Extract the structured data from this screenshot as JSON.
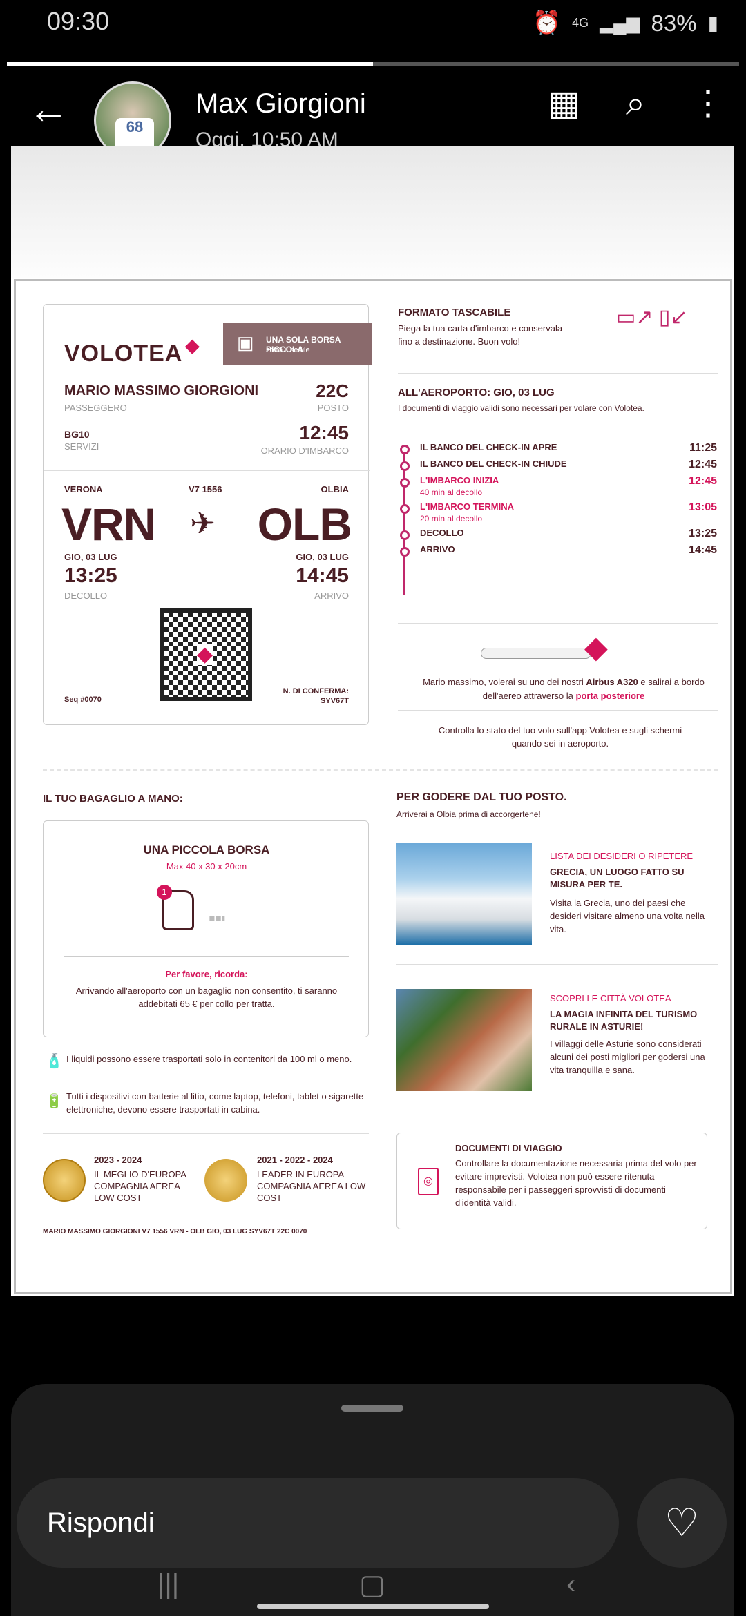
{
  "status_bar": {
    "time": "09:30",
    "network": "4G",
    "battery": "83%"
  },
  "story_progress": 0.5,
  "header": {
    "name": "Max Giorgioni",
    "date": "Oggi, 10:50 AM"
  },
  "boarding_pass": {
    "brand": "VOLOTEA",
    "bag_tag_title": "UNA SOLA BORSA PICCOLA",
    "bag_tag_sub": "sotto il sedile",
    "passenger_name": "MARIO MASSIMO GIORGIONI",
    "passenger_label": "PASSEGGERO",
    "seat": "22C",
    "seat_label": "POSTO",
    "service_code": "BG10",
    "service_label": "SERVIZI",
    "boarding_time": "12:45",
    "boarding_label": "ORARIO D'IMBARCO",
    "from_city": "VERONA",
    "flight": "V7 1556",
    "to_city": "OLBIA",
    "from_code": "VRN",
    "to_code": "OLB",
    "dep_date": "GIO, 03 LUG",
    "arr_date": "GIO, 03 LUG",
    "dep_time": "13:25",
    "arr_time": "14:45",
    "dep_label": "DECOLLO",
    "arr_label": "ARRIVO",
    "seq": "Seq #0070",
    "conf_label": "N. DI CONFERMA:",
    "conf_code": "SYV67T"
  },
  "pocket": {
    "title": "FORMATO TASCABILE",
    "text": "Piega la tua carta d'imbarco e conservala fino a destinazione. Buon volo!"
  },
  "airport": {
    "title": "ALL'AEROPORTO: GIO, 03 LUG",
    "subtitle": "I documenti di viaggio validi sono necessari per volare con Volotea.",
    "steps": [
      {
        "label": "IL BANCO DEL CHECK-IN APRE",
        "sub": "",
        "time": "11:25"
      },
      {
        "label": "IL BANCO DEL CHECK-IN CHIUDE",
        "sub": "",
        "time": "12:45"
      },
      {
        "label": "L'IMBARCO INIZIA",
        "sub": "40  min al decollo",
        "time": "12:45"
      },
      {
        "label": "L'IMBARCO TERMINA",
        "sub": "20  min al decollo",
        "time": "13:05"
      },
      {
        "label": "DECOLLO",
        "sub": "",
        "time": "13:25"
      },
      {
        "label": "ARRIVO",
        "sub": "",
        "time": "14:45"
      }
    ]
  },
  "aircraft": {
    "text_pre": "Mario massimo, volerai su uno dei nostri",
    "aircraft_model": "Airbus A320",
    "text_mid": "e salirai a bordo dell'aereo attraverso la",
    "door": "porta posteriore",
    "app_text": "Controlla lo stato del tuo volo sull'app Volotea e sugli schermi quando sei in aeroporto."
  },
  "baggage": {
    "title": "IL TUO BAGAGLIO A MANO:",
    "item": "UNA PICCOLA BORSA",
    "dims": "Max 40 x 30 x 20cm",
    "badge": "1",
    "remember": "Per favore, ricorda:",
    "remember_text": "Arrivando all'aeroporto con un bagaglio non consentito, ti saranno addebitati 65 € per collo per tratta.",
    "liquids": "I liquidi possono essere trasportati solo in contenitori da 100 ml o meno.",
    "batteries": "Tutti i dispositivi con batterie al litio, come laptop, telefoni, tablet o sigarette elettroniche, devono essere trasportati in cabina."
  },
  "awards": [
    {
      "years": "2023 - 2024",
      "text": "IL MEGLIO D'EUROPA COMPAGNIA AEREA LOW COST"
    },
    {
      "years": "2021 - 2022 - 2024",
      "text": "LEADER IN EUROPA COMPAGNIA AEREA LOW COST"
    }
  ],
  "footer_code": "MARIO MASSIMO GIORGIONI V7 1556 VRN - OLB GIO, 03 LUG SYV67T 22C 0070",
  "enjoy": {
    "title": "PER GODERE DAL TUO POSTO.",
    "subtitle": "Arriverai a Olbia prima di accorgertene!",
    "cards": [
      {
        "tag": "LISTA DEI DESIDERI O RIPETERE",
        "headline": "GRECIA, UN LUOGO FATTO SU MISURA PER TE.",
        "text": "Visita la Grecia, uno dei paesi che desideri visitare almeno una volta nella vita."
      },
      {
        "tag": "SCOPRI LE CITTÀ VOLOTEA",
        "headline": "LA MAGIA INFINITA DEL TURISMO RURALE IN ASTURIE!",
        "text": "I villaggi delle Asturie sono considerati alcuni dei posti migliori per godersi una vita tranquilla e sana."
      }
    ]
  },
  "documents": {
    "title": "DOCUMENTI DI VIAGGIO",
    "text": "Controllare la documentazione necessaria prima del volo per evitare imprevisti. Volotea non può essere ritenuta responsabile per i passeggeri sprovvisti di documenti d'identità validi."
  },
  "reply": {
    "placeholder": "Rispondi"
  },
  "colors": {
    "brand_brown": "#4a1e24",
    "accent_pink": "#d4145a",
    "tag_bg": "#8a6a6c"
  },
  "icons": [
    "back-arrow-icon",
    "grid-icon",
    "search-icon",
    "more-icon",
    "plane-icon",
    "heart-icon",
    "backpack-icon",
    "seat-icon",
    "liquid-icon",
    "battery-icon",
    "passport-icon"
  ]
}
